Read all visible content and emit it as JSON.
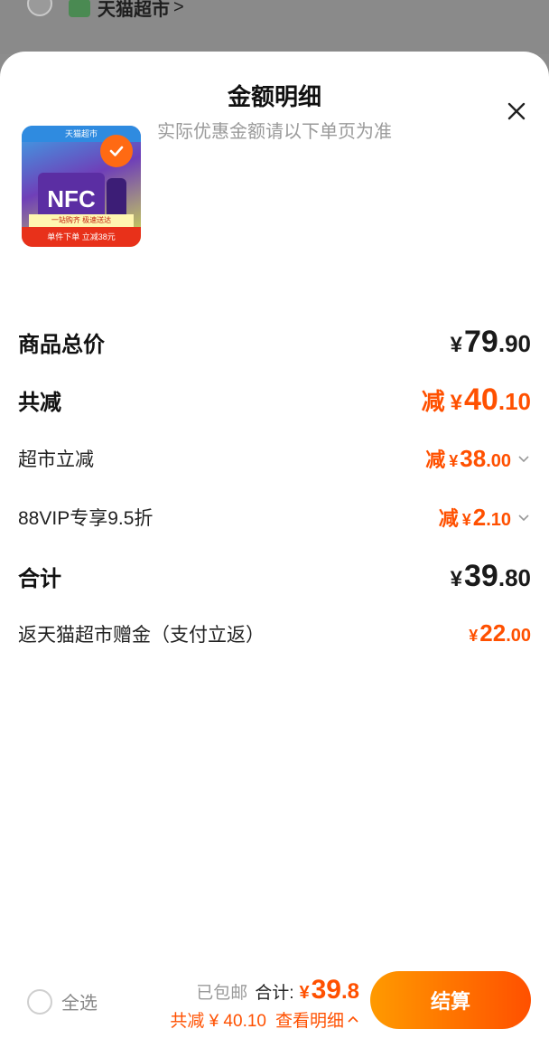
{
  "background": {
    "store_name": "天猫超市",
    "store_chevron": ">"
  },
  "sheet": {
    "title": "金额明细",
    "subtitle": "实际优惠金额请以下单页为准",
    "close_icon": "close-icon"
  },
  "product": {
    "thumb_top_text": "天猫超市",
    "thumb_brand": "NFC",
    "thumb_mid_text": "一站购齐 极速送达",
    "thumb_bottom_text": "单件下单 立减38元",
    "selected": true
  },
  "rows": {
    "goods_total": {
      "label": "商品总价",
      "currency": "¥",
      "int": "79",
      "dec": ".90"
    },
    "total_discount": {
      "label": "共减",
      "prefix": "减",
      "currency": "¥",
      "int": "40",
      "dec": ".10"
    },
    "supermarket_discount": {
      "label": "超市立减",
      "prefix": "减",
      "currency": "¥",
      "int": "38",
      "dec": ".00"
    },
    "vip_discount": {
      "label": "88VIP专享9.5折",
      "prefix": "减",
      "currency": "¥",
      "int": "2",
      "dec": ".10"
    },
    "subtotal": {
      "label": "合计",
      "currency": "¥",
      "int": "39",
      "dec": ".80"
    },
    "cashback": {
      "label": "返天猫超市赠金（支付立返）",
      "currency": "¥",
      "int": "22",
      "dec": ".00"
    }
  },
  "footer": {
    "select_all_label": "全选",
    "shipping_label": "已包邮",
    "total_label": "合计:",
    "total_currency": "¥",
    "total_int": "39",
    "total_dec": ".8",
    "saved_label": "共减 ¥ 40.10",
    "details_label": "查看明细",
    "checkout_label": "结算"
  },
  "colors": {
    "accent": "#ff5000",
    "accent_gradient_start": "#ff9a00",
    "muted": "#9a9a9a"
  }
}
